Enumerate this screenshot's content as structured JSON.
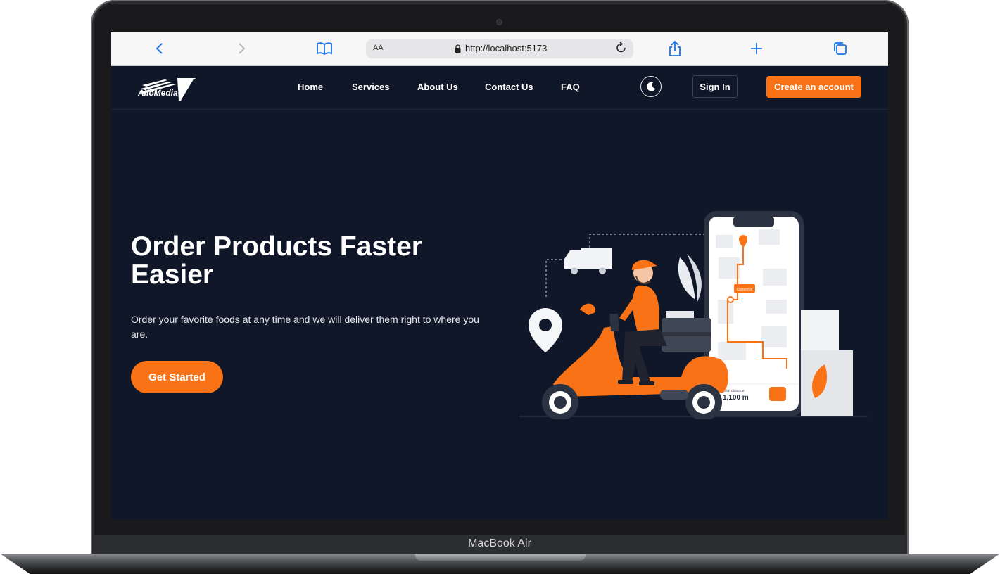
{
  "device": {
    "label": "MacBook Air"
  },
  "browser": {
    "text_size_label": "AA",
    "url": "http://localhost:5173",
    "icons": [
      "chevron-left-icon",
      "chevron-right-icon",
      "book-icon",
      "lock-icon",
      "reload-icon",
      "share-icon",
      "plus-icon",
      "tabs-icon"
    ]
  },
  "nav": {
    "logo_text": "AlloMedia",
    "links": [
      "Home",
      "Services",
      "About Us",
      "Contact Us",
      "FAQ"
    ],
    "theme_icon": "moon-icon",
    "signin_label": "Sign In",
    "create_label": "Create an account"
  },
  "hero": {
    "title": "Order Products Faster Easier",
    "subtitle": "Order your favorite foods at any time and we will deliver them right to where you are.",
    "cta_label": "Get Started"
  },
  "illustration": {
    "map_tag": "Clipperton",
    "distance_label": "Total distance",
    "distance_value": "1,100 m"
  },
  "colors": {
    "accent": "#f97316",
    "background": "#0f1729",
    "text": "#ffffff"
  }
}
